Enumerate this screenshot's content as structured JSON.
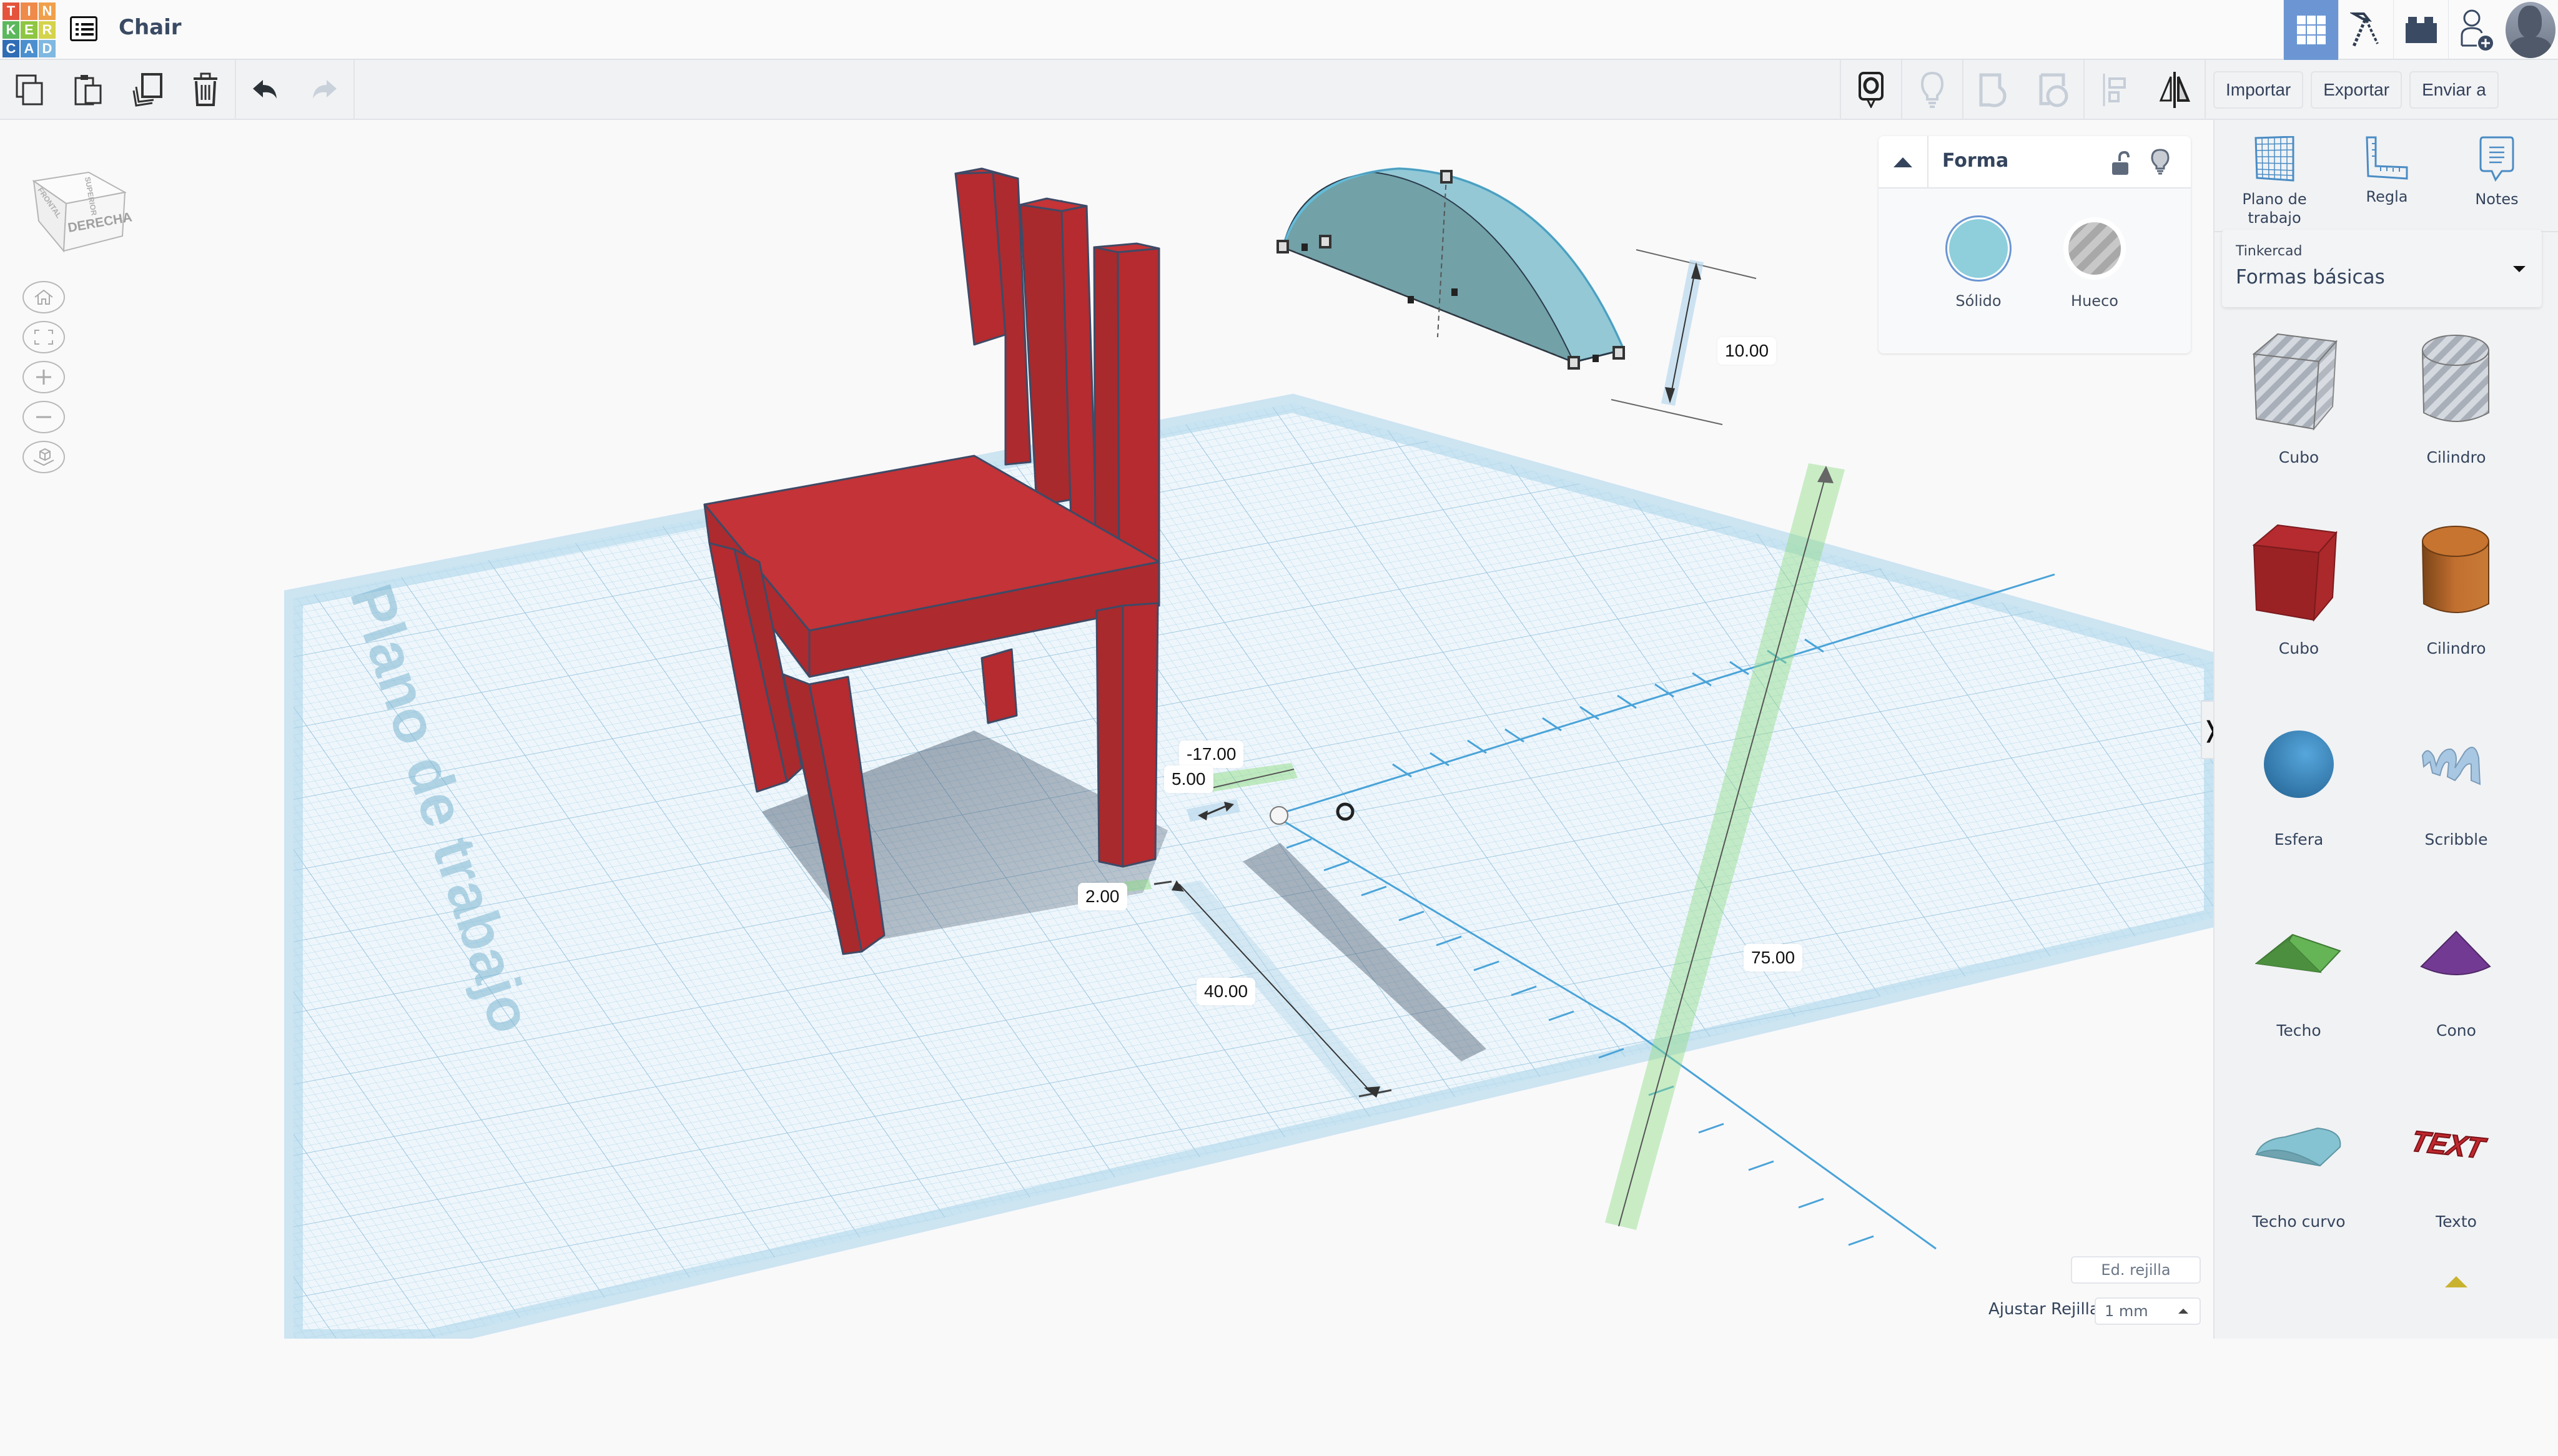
{
  "header": {
    "logo_letters": [
      "T",
      "I",
      "N",
      "K",
      "E",
      "R",
      "C",
      "A",
      "D"
    ],
    "logo_colors": [
      "#e5533c",
      "#ef8a4a",
      "#f0a04b",
      "#5cb85c",
      "#8ec641",
      "#d4d34b",
      "#2f6db5",
      "#4b8fcf",
      "#7fb8e0"
    ],
    "doc_title": "Chair",
    "right_buttons": [
      {
        "icon": "3d-view-grid-icon",
        "active": true
      },
      {
        "icon": "blocks-pickaxe-icon",
        "active": false
      },
      {
        "icon": "bricks-lego-icon",
        "active": false
      },
      {
        "icon": "add-user-icon",
        "active": false
      }
    ]
  },
  "toolbar": {
    "left_tools": [
      "copy-icon",
      "paste-icon",
      "duplicate-icon",
      "delete-icon"
    ],
    "undo": "undo-icon",
    "redo": "redo-icon",
    "right_tools": [
      "notes-toggle-icon",
      "light-bulb-icon",
      "group-icon",
      "ungroup-icon",
      "align-icon",
      "mirror-icon"
    ],
    "import_label": "Importar",
    "export_label": "Exportar",
    "send_label": "Enviar a"
  },
  "viewcube": {
    "front_face": "DERECHA",
    "side_face": "FRONTAL",
    "top_face": "SUPERIOR"
  },
  "nav_buttons": [
    "home-view-icon",
    "fit-all-icon",
    "zoom-in-icon",
    "zoom-out-icon",
    "perspective-icon"
  ],
  "workplane": {
    "label": "Plano de trabajo",
    "dimensions": {
      "x_offset": "-17.00",
      "y_offset": "5.00",
      "gap": "2.00",
      "length": "40.00",
      "height_elevation": "75.00",
      "shape_height": "10.00"
    }
  },
  "inspector": {
    "title": "Forma",
    "solid_label": "Sólido",
    "hole_label": "Hueco",
    "solid_color": "#8ecfdb",
    "selected": "solid"
  },
  "grid": {
    "edit_label": "Ed. rejilla",
    "snap_label": "Ajustar Rejilla",
    "snap_value": "1 mm"
  },
  "panel": {
    "tools": [
      {
        "label": "Plano de trabajo",
        "icon": "workplane-icon"
      },
      {
        "label": "Regla",
        "icon": "ruler-icon"
      },
      {
        "label": "Notes",
        "icon": "notes-icon"
      }
    ],
    "library_source": "Tinkercad",
    "library_name": "Formas básicas",
    "shapes": [
      {
        "label": "Cubo",
        "kind": "hole-cube"
      },
      {
        "label": "Cilindro",
        "kind": "hole-cylinder"
      },
      {
        "label": "Cubo",
        "kind": "cube"
      },
      {
        "label": "Cilindro",
        "kind": "cylinder"
      },
      {
        "label": "Esfera",
        "kind": "sphere"
      },
      {
        "label": "Scribble",
        "kind": "scribble"
      },
      {
        "label": "Techo",
        "kind": "roof"
      },
      {
        "label": "Cono",
        "kind": "cone"
      },
      {
        "label": "Techo curvo",
        "kind": "round-roof"
      },
      {
        "label": "Texto",
        "kind": "text"
      }
    ],
    "text_shape_word": "TEXT",
    "colors": {
      "cube": "#b52b2f",
      "cylinder": "#c77431",
      "sphere": "#3f92c9",
      "roof": "#5ba84f",
      "cone": "#733a94",
      "round_roof": "#86c3d2",
      "text": "#c0272d"
    }
  }
}
